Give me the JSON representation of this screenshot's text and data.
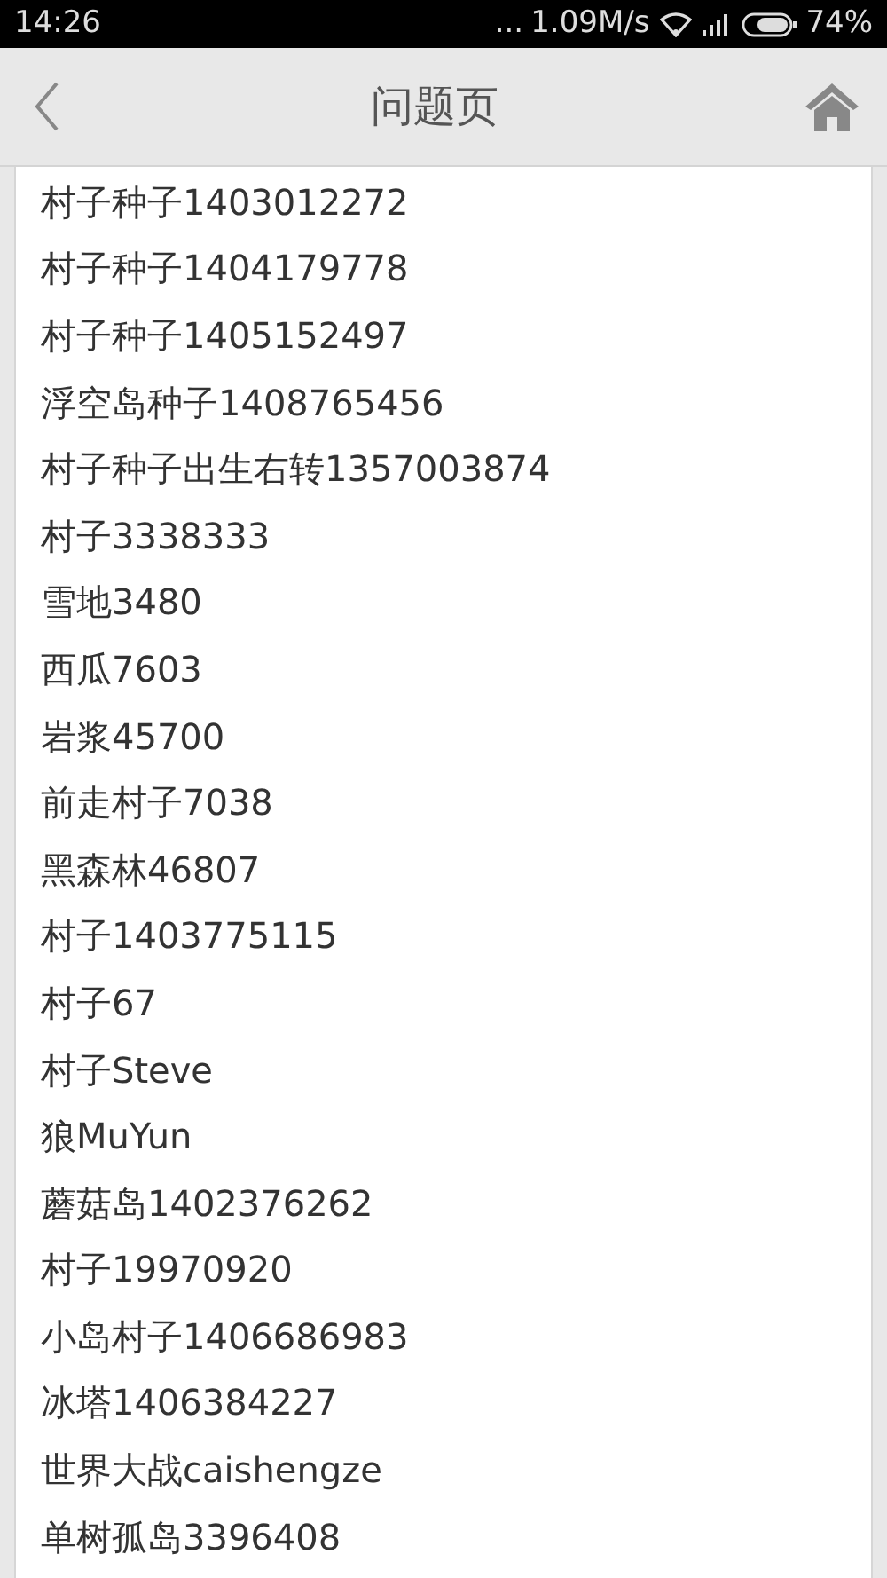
{
  "status_bar": {
    "time": "14:26",
    "dots": "...",
    "speed": "1.09M/s",
    "battery": "74%"
  },
  "header": {
    "title": "问题页"
  },
  "items": [
    "村子种子1403012272",
    "村子种子1404179778",
    "村子种子1405152497",
    "浮空岛种子1408765456",
    "村子种子出生右转1357003874",
    "村子3338333",
    "雪地3480",
    "西瓜7603",
    "岩浆45700",
    "前走村子7038",
    "黑森林46807",
    "村子1403775115",
    "村子67",
    "村子Steve",
    "狼MuYun",
    "蘑菇岛1402376262",
    "村子19970920",
    "小岛村子1406686983",
    "冰塔1406384227",
    "世界大战caishengze",
    "单树孤岛3396408"
  ]
}
